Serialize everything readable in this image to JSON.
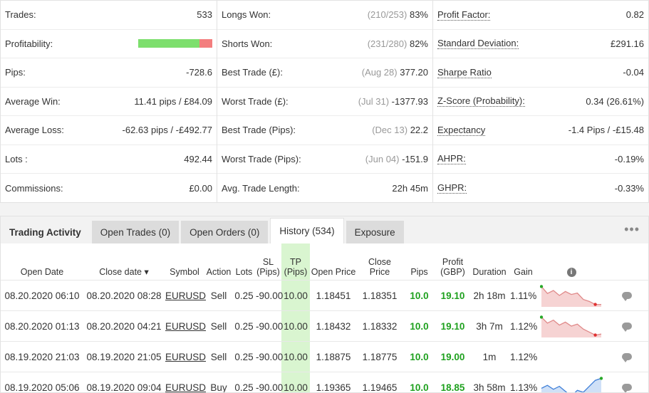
{
  "stats": {
    "col1": [
      {
        "label": "Trades:",
        "value": "533"
      },
      {
        "label": "Profitability:",
        "bar": {
          "win_fraction": 0.83
        }
      },
      {
        "label": "Pips:",
        "value": "-728.6"
      },
      {
        "label": "Average Win:",
        "value": "11.41 pips / £84.09"
      },
      {
        "label": "Average Loss:",
        "value": "-62.63 pips / -£492.77"
      },
      {
        "label": "Lots :",
        "value": "492.44"
      },
      {
        "label": "Commissions:",
        "value": "£0.00"
      }
    ],
    "col2": [
      {
        "label": "Longs Won:",
        "note": "(210/253)",
        "value": "83%"
      },
      {
        "label": "Shorts Won:",
        "note": "(231/280)",
        "value": "82%"
      },
      {
        "label": "Best Trade (£):",
        "note": "(Aug 28)",
        "value": "377.20"
      },
      {
        "label": "Worst Trade (£):",
        "note": "(Jul 31)",
        "value": "-1377.93"
      },
      {
        "label": "Best Trade (Pips):",
        "note": "(Dec 13)",
        "value": "22.2"
      },
      {
        "label": "Worst Trade (Pips):",
        "note": "(Jun 04)",
        "value": "-151.9"
      },
      {
        "label": "Avg. Trade Length:",
        "note": "",
        "value": "22h 45m"
      }
    ],
    "col3": [
      {
        "label": "Profit Factor:",
        "value": "0.82"
      },
      {
        "label": "Standard Deviation:",
        "value": "£291.16"
      },
      {
        "label": "Sharpe Ratio",
        "value": "-0.04"
      },
      {
        "label": "Z-Score (Probability):",
        "value": "0.34 (26.61%)"
      },
      {
        "label": "Expectancy",
        "value": "-1.4 Pips / -£15.48"
      },
      {
        "label": "AHPR:",
        "value": "-0.19%"
      },
      {
        "label": "GHPR:",
        "value": "-0.33%"
      }
    ]
  },
  "tabs": {
    "trading_activity": "Trading Activity",
    "open_trades": "Open Trades (0)",
    "open_orders": "Open Orders (0)",
    "history": "History (534)",
    "exposure": "Exposure",
    "more": "•••"
  },
  "table": {
    "headers": {
      "open_date": "Open Date",
      "close_date": "Close date ▾",
      "symbol": "Symbol",
      "action": "Action",
      "lots": "Lots",
      "sl": "SL",
      "sl_sub": "(Pips)",
      "tp": "TP",
      "tp_sub": "(Pips)",
      "open_price": "Open Price",
      "close_price": "Close Price",
      "pips": "Pips",
      "profit": "Profit",
      "profit_sub": "(GBP)",
      "duration": "Duration",
      "gain": "Gain",
      "info": "i"
    },
    "rows": [
      {
        "open_date": "08.20.2020 06:10",
        "close_date": "08.20.2020 08:28",
        "symbol": "EURUSD",
        "action": "Sell",
        "lots": "0.25",
        "sl": "-90.00",
        "tp": "10.00",
        "open_price": "1.18451",
        "close_price": "1.18351",
        "pips": "10.0",
        "profit": "19.10",
        "duration": "2h 18m",
        "gain": "1.11%",
        "spark": {
          "type": "red",
          "values": [
            0.95,
            0.6,
            0.75,
            0.5,
            0.7,
            0.55,
            0.62,
            0.3,
            0.2,
            0.05,
            0.05
          ]
        }
      },
      {
        "open_date": "08.20.2020 01:13",
        "close_date": "08.20.2020 04:21",
        "symbol": "EURUSD",
        "action": "Sell",
        "lots": "0.25",
        "sl": "-90.00",
        "tp": "10.00",
        "open_price": "1.18432",
        "close_price": "1.18332",
        "pips": "10.0",
        "profit": "19.10",
        "duration": "3h 7m",
        "gain": "1.12%",
        "spark": {
          "type": "red",
          "values": [
            0.95,
            0.65,
            0.8,
            0.55,
            0.7,
            0.5,
            0.6,
            0.35,
            0.2,
            0.05,
            0.1
          ]
        }
      },
      {
        "open_date": "08.19.2020 21:03",
        "close_date": "08.19.2020 21:05",
        "symbol": "EURUSD",
        "action": "Sell",
        "lots": "0.25",
        "sl": "-90.00",
        "tp": "10.00",
        "open_price": "1.18875",
        "close_price": "1.18775",
        "pips": "10.0",
        "profit": "19.00",
        "duration": "1m",
        "gain": "1.12%",
        "spark": null
      },
      {
        "open_date": "08.19.2020 05:06",
        "close_date": "08.19.2020 09:04",
        "symbol": "EURUSD",
        "action": "Buy",
        "lots": "0.25",
        "sl": "-90.00",
        "tp": "10.00",
        "open_price": "1.19365",
        "close_price": "1.19465",
        "pips": "10.0",
        "profit": "18.85",
        "duration": "3h 58m",
        "gain": "1.13%",
        "spark": {
          "type": "blue",
          "values": [
            0.45,
            0.6,
            0.4,
            0.55,
            0.3,
            0.05,
            0.35,
            0.25,
            0.55,
            0.85,
            0.95
          ]
        }
      }
    ]
  },
  "colors": {
    "win": "#7ddf6d",
    "loss": "#f37e7e",
    "profit_green": "#1fa11f",
    "tp_highlight": "#d9f5d0"
  }
}
